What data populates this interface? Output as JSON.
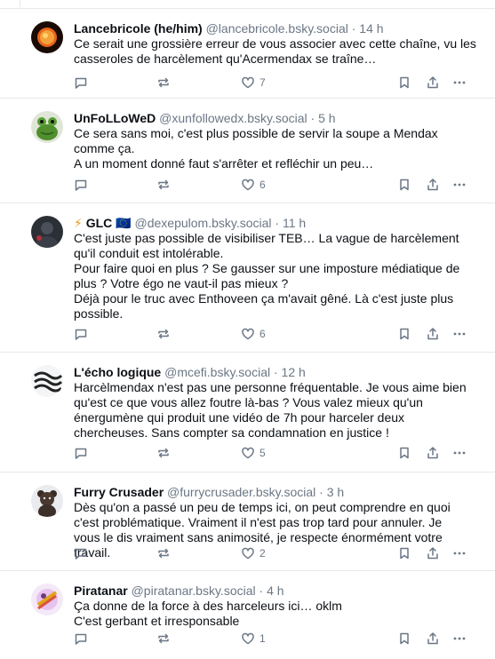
{
  "posts": [
    {
      "name": "Lancebricole (he/him)",
      "handle": "@lancebricole.bsky.social",
      "time": "14 h",
      "lines": [
        "Ce serait une grossière erreur de vous associer avec cette chaîne, vu les casseroles de harcèlement qu'Acermendax se traîne…"
      ],
      "likes": "7",
      "avatar": "sun-avatar"
    },
    {
      "name": "UnFoLLoWeD",
      "handle": "@xunfollowedx.bsky.social",
      "time": "5 h",
      "lines": [
        "Ce sera sans moi, c'est plus possible de servir la soupe a Mendax comme ça.",
        "A un moment donné faut s'arrêter et refléchir un peu…"
      ],
      "likes": "6",
      "avatar": "frog-avatar"
    },
    {
      "name": "GLC 🇪🇺",
      "name_prefix": "⚡",
      "handle": "@dexepulom.bsky.social",
      "time": "11 h",
      "lines": [
        "C'est juste pas possible de visibiliser TEB… La vague de harcèlement qu'il conduit est intolérable.",
        "Pour faire quoi en plus ? Se gausser sur une imposture médiatique de plus ? Votre égo ne vaut-il pas mieux ?",
        "Déjà pour le truc avec Enthoveen ça m'avait gêné. Là c'est juste plus possible."
      ],
      "likes": "6",
      "avatar": "dark-avatar"
    },
    {
      "name": "L'écho logique",
      "handle": "@mcefi.bsky.social",
      "time": "12 h",
      "lines": [
        "Harcèlmendax n'est pas une personne fréquentable. Je vous aime bien qu'est ce que vous allez foutre là-bas ? Vous valez mieux qu'un énergumène qui produit une vidéo de 7h pour harceler deux chercheuses. Sans compter sa condamnation en justice !"
      ],
      "likes": "5",
      "avatar": "wave-avatar"
    },
    {
      "name": "Furry Crusader",
      "handle": "@furrycrusader.bsky.social",
      "time": "3 h",
      "lines": [
        "Dès qu'on a passé un peu de temps ici, on peut comprendre en quoi c'est problématique. Vraiment il n'est pas trop tard pour annuler. Je vous le dis vraiment sans animosité, je respecte énormément votre travail."
      ],
      "likes": "2",
      "avatar": "bear-avatar"
    },
    {
      "name": "Piratanar",
      "handle": "@piratanar.bsky.social",
      "time": "4 h",
      "lines": [
        "Ça donne de la force à des harceleurs ici… oklm",
        "C'est gerbant et irresponsable"
      ],
      "likes": "1",
      "avatar": "pirate-avatar"
    }
  ],
  "dot": "·",
  "colors": {
    "text": "#0b0f14",
    "muted": "#6b7785",
    "divider": "#e6e8eb"
  }
}
